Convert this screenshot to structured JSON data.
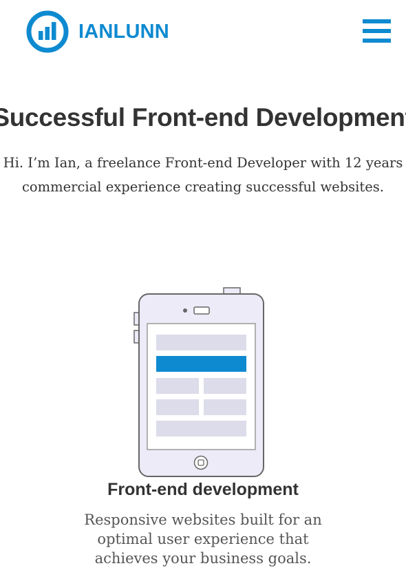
{
  "header": {
    "logo_text": "IANLUNN",
    "logo_icon": "bar-chart-circle-icon",
    "menu_icon": "hamburger-menu-icon"
  },
  "hero": {
    "title": "Successful Front-end Development",
    "intro_line1": "Hi. I’m Ian, a freelance Front-end Developer with 12 years",
    "intro_line2": "commercial experience creating successful websites."
  },
  "service": {
    "icon": "tablet-device-icon",
    "title": "Front-end development",
    "description_line1": "Responsive websites built for an",
    "description_line2": "optimal user experience that",
    "description_line3": "achieves your business goals."
  },
  "colors": {
    "brand_blue": "#0e8ad0",
    "text_dark": "#333333",
    "text_muted": "#555555",
    "device_fill": "#ecebf7",
    "device_stroke": "#666666",
    "placeholder_block": "#dcdcea"
  }
}
